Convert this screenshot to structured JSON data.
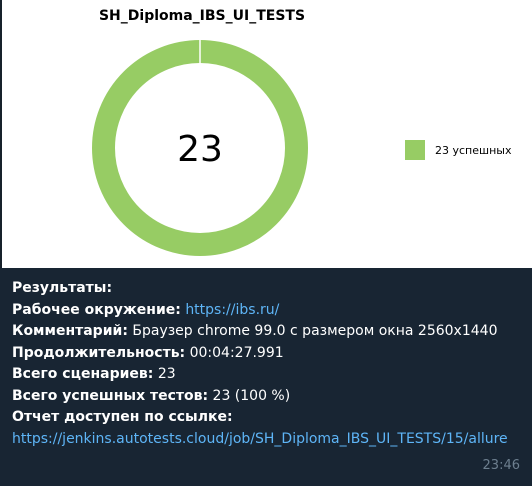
{
  "chart_data": {
    "type": "pie",
    "title": "SH_Diploma_IBS_UI_TESTS",
    "center_label": "23",
    "categories": [
      "23 успешных"
    ],
    "values": [
      23
    ],
    "colors": [
      "#97cc64"
    ],
    "legend_position": "right"
  },
  "message": {
    "results_label": "Результаты:",
    "env_label": "Рабочее окружение:",
    "env_link": "https://ibs.ru/",
    "comment_label": "Комментарий:",
    "comment_value": "Браузер chrome 99.0 с размером окна 2560x1440",
    "duration_label": "Продолжительность:",
    "duration_value": "00:04:27.991",
    "scenarios_label": "Всего сценариев:",
    "scenarios_value": "23",
    "passed_label": "Всего успешных тестов:",
    "passed_value": "23 (100 %)",
    "report_label": "Отчет доступен по ссылке:",
    "report_link": "https://jenkins.autotests.cloud/job/SH_Diploma_IBS_UI_TESTS/15/allure",
    "time": "23:46"
  }
}
